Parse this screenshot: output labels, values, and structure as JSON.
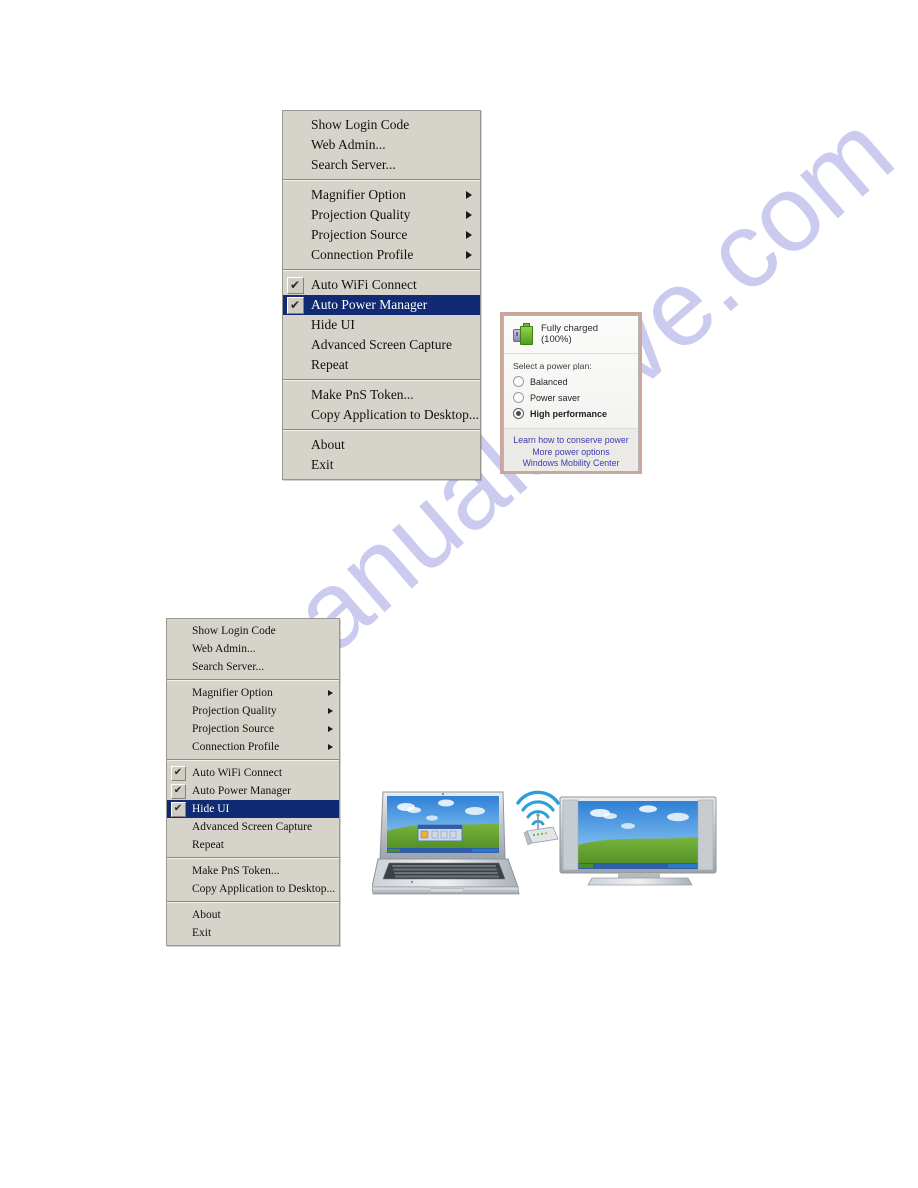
{
  "page": {
    "watermark": "manualshive.com"
  },
  "menu_top": {
    "name": "tray-context-menu-auto-power-manager",
    "groups": [
      {
        "items": [
          {
            "label": "Show Login Code",
            "type": "plain",
            "checked": false,
            "submenu": false,
            "selected": false
          },
          {
            "label": "Web Admin...",
            "type": "plain",
            "checked": false,
            "submenu": false,
            "selected": false
          },
          {
            "label": "Search Server...",
            "type": "plain",
            "checked": false,
            "submenu": false,
            "selected": false
          }
        ]
      },
      {
        "items": [
          {
            "label": "Magnifier Option",
            "type": "submenu",
            "checked": false,
            "submenu": true,
            "selected": false
          },
          {
            "label": "Projection Quality",
            "type": "submenu",
            "checked": false,
            "submenu": true,
            "selected": false
          },
          {
            "label": "Projection Source",
            "type": "submenu",
            "checked": false,
            "submenu": true,
            "selected": false
          },
          {
            "label": "Connection Profile",
            "type": "submenu",
            "checked": false,
            "submenu": true,
            "selected": false
          }
        ]
      },
      {
        "items": [
          {
            "label": "Auto WiFi Connect",
            "type": "check",
            "checked": true,
            "submenu": false,
            "selected": false
          },
          {
            "label": "Auto Power Manager",
            "type": "check",
            "checked": true,
            "submenu": false,
            "selected": true
          },
          {
            "label": "Hide UI",
            "type": "plain",
            "checked": false,
            "submenu": false,
            "selected": false
          },
          {
            "label": "Advanced Screen Capture",
            "type": "plain",
            "checked": false,
            "submenu": false,
            "selected": false
          },
          {
            "label": "Repeat",
            "type": "plain",
            "checked": false,
            "submenu": false,
            "selected": false
          }
        ]
      },
      {
        "items": [
          {
            "label": "Make PnS Token...",
            "type": "plain",
            "checked": false,
            "submenu": false,
            "selected": false
          },
          {
            "label": "Copy Application to Desktop...",
            "type": "plain",
            "checked": false,
            "submenu": false,
            "selected": false
          }
        ]
      },
      {
        "items": [
          {
            "label": "About",
            "type": "plain",
            "checked": false,
            "submenu": false,
            "selected": false
          },
          {
            "label": "Exit",
            "type": "plain",
            "checked": false,
            "submenu": false,
            "selected": false
          }
        ]
      }
    ]
  },
  "menu_bottom": {
    "name": "tray-context-menu-hide-ui",
    "groups": [
      {
        "items": [
          {
            "label": "Show Login Code",
            "type": "plain",
            "checked": false,
            "submenu": false,
            "selected": false
          },
          {
            "label": "Web Admin...",
            "type": "plain",
            "checked": false,
            "submenu": false,
            "selected": false
          },
          {
            "label": "Search Server...",
            "type": "plain",
            "checked": false,
            "submenu": false,
            "selected": false
          }
        ]
      },
      {
        "items": [
          {
            "label": "Magnifier Option",
            "type": "submenu",
            "checked": false,
            "submenu": true,
            "selected": false
          },
          {
            "label": "Projection Quality",
            "type": "submenu",
            "checked": false,
            "submenu": true,
            "selected": false
          },
          {
            "label": "Projection Source",
            "type": "submenu",
            "checked": false,
            "submenu": true,
            "selected": false
          },
          {
            "label": "Connection Profile",
            "type": "submenu",
            "checked": false,
            "submenu": true,
            "selected": false
          }
        ]
      },
      {
        "items": [
          {
            "label": "Auto WiFi Connect",
            "type": "check",
            "checked": true,
            "submenu": false,
            "selected": false
          },
          {
            "label": "Auto Power Manager",
            "type": "check",
            "checked": true,
            "submenu": false,
            "selected": false
          },
          {
            "label": "Hide UI",
            "type": "check",
            "checked": true,
            "submenu": false,
            "selected": true
          },
          {
            "label": "Advanced Screen Capture",
            "type": "plain",
            "checked": false,
            "submenu": false,
            "selected": false
          },
          {
            "label": "Repeat",
            "type": "plain",
            "checked": false,
            "submenu": false,
            "selected": false
          }
        ]
      },
      {
        "items": [
          {
            "label": "Make PnS Token...",
            "type": "plain",
            "checked": false,
            "submenu": false,
            "selected": false
          },
          {
            "label": "Copy Application to Desktop...",
            "type": "plain",
            "checked": false,
            "submenu": false,
            "selected": false
          }
        ]
      },
      {
        "items": [
          {
            "label": "About",
            "type": "plain",
            "checked": false,
            "submenu": false,
            "selected": false
          },
          {
            "label": "Exit",
            "type": "plain",
            "checked": false,
            "submenu": false,
            "selected": false
          }
        ]
      }
    ]
  },
  "power_flyout": {
    "battery_status": "Fully charged (100%)",
    "plan_label": "Select a power plan:",
    "plans": [
      {
        "label": "Balanced",
        "selected": false
      },
      {
        "label": "Power saver",
        "selected": false
      },
      {
        "label": "High performance",
        "selected": true
      }
    ],
    "links": [
      "Learn how to conserve power",
      "More power options",
      "Windows Mobility Center"
    ]
  },
  "illustration": {
    "name": "laptop-to-tv-wireless-projection",
    "devices": [
      "laptop",
      "wireless-router",
      "flat-panel-tv"
    ]
  },
  "colors": {
    "menu_bg": "#d6d3ca",
    "menu_border": "#9a978e",
    "highlight": "#102a73",
    "highlight_text": "#ffffff",
    "watermark": "#c9c8ef",
    "flyout_border": "#c9a79d",
    "link": "#3b3bb0"
  },
  "icons": {
    "checkmark": "✔",
    "submenu_arrow": "right-triangle-icon",
    "battery": "battery-full-icon"
  }
}
